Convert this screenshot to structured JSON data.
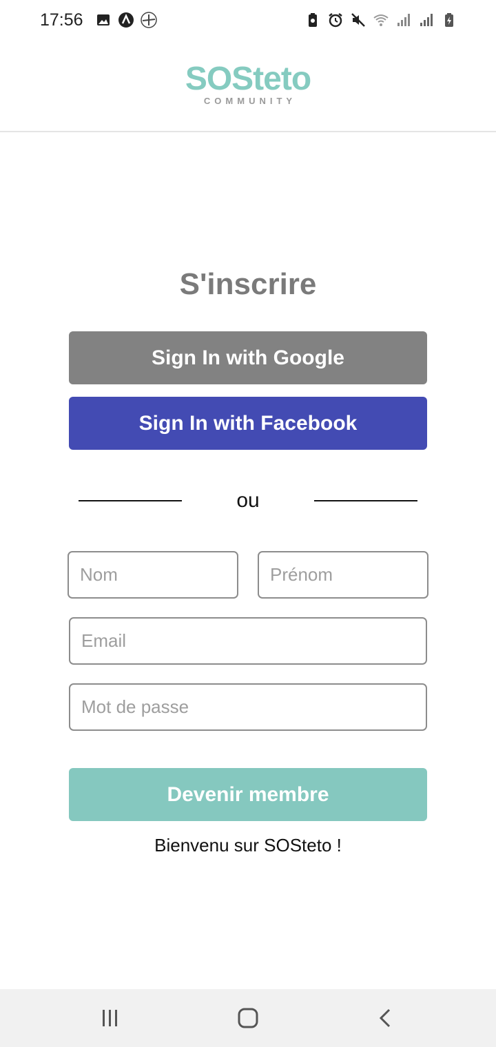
{
  "status_bar": {
    "time": "17:56",
    "left_icons": [
      "image-icon",
      "app-a-icon",
      "plane-icon"
    ],
    "right_icons": [
      "battery-saver-icon",
      "alarm-icon",
      "mute-icon",
      "wifi-icon",
      "signal-icon",
      "signal-icon-2",
      "battery-icon"
    ]
  },
  "header": {
    "logo_text": "SOSteto",
    "logo_subtext": "COMMUNITY",
    "logo_color": "#85cbc0"
  },
  "page": {
    "title": "S'inscrire",
    "google_button": "Sign In with Google",
    "facebook_button": "Sign In with Facebook",
    "divider_text": "ou",
    "fields": {
      "nom_placeholder": "Nom",
      "prenom_placeholder": "Prénom",
      "email_placeholder": "Email",
      "password_placeholder": "Mot de passe"
    },
    "join_button": "Devenir membre",
    "welcome_text": "Bienvenu sur SOSteto !"
  },
  "colors": {
    "google": "#828282",
    "facebook": "#434bb3",
    "join": "#85c8bf",
    "title": "#7a7a7a"
  },
  "nav_bar": {
    "items": [
      "recent-apps-icon",
      "home-icon",
      "back-icon"
    ]
  }
}
